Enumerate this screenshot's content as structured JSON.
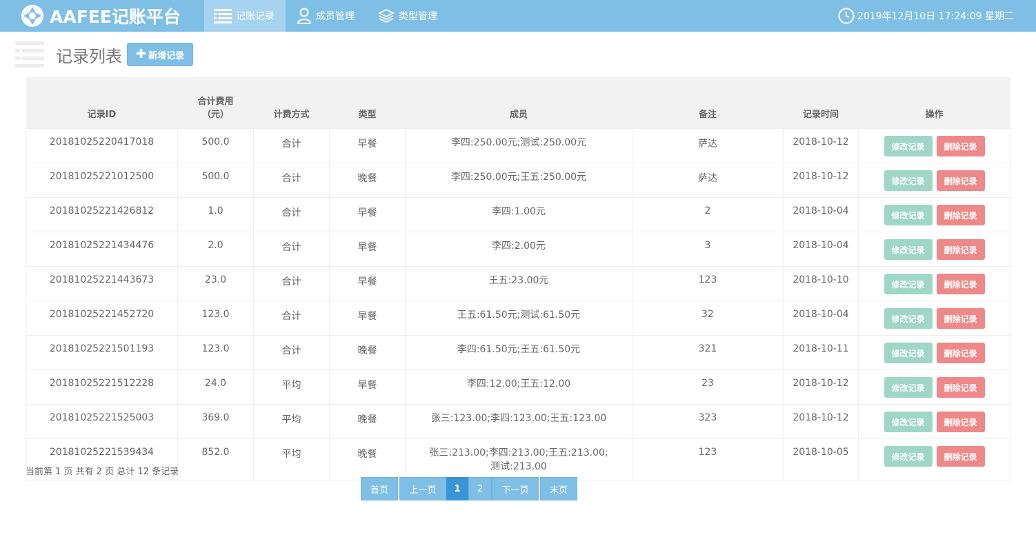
{
  "app": {
    "brand": "AAFEE记账平台",
    "nav": [
      {
        "label": "记账记录",
        "icon": "list-icon",
        "active": true
      },
      {
        "label": "成员管理",
        "icon": "user-icon",
        "active": false
      },
      {
        "label": "类型管理",
        "icon": "layers-icon",
        "active": false
      }
    ],
    "clock": "2019年12月10日 17:24:09 星期二"
  },
  "page": {
    "title": "记录列表",
    "add_button": "新增记录"
  },
  "table": {
    "headers": [
      "记录ID",
      "合计费用\n（元）",
      "计费方式",
      "类型",
      "成员",
      "备注",
      "记录时间",
      "操作"
    ],
    "edit_label": "修改记录",
    "delete_label": "删除记录",
    "rows": [
      {
        "id": "20181025220417018",
        "total": "500.0",
        "method": "合计",
        "type": "早餐",
        "members": "李四:250.00元;测试:250.00元",
        "note": "萨达",
        "date": "2018-10-12"
      },
      {
        "id": "20181025221012500",
        "total": "500.0",
        "method": "合计",
        "type": "晚餐",
        "members": "李四:250.00元;王五:250.00元",
        "note": "萨达",
        "date": "2018-10-12"
      },
      {
        "id": "20181025221426812",
        "total": "1.0",
        "method": "合计",
        "type": "早餐",
        "members": "李四:1.00元",
        "note": "2",
        "date": "2018-10-04"
      },
      {
        "id": "20181025221434476",
        "total": "2.0",
        "method": "合计",
        "type": "早餐",
        "members": "李四:2.00元",
        "note": "3",
        "date": "2018-10-04"
      },
      {
        "id": "20181025221443673",
        "total": "23.0",
        "method": "合计",
        "type": "早餐",
        "members": "王五:23.00元",
        "note": "123",
        "date": "2018-10-10"
      },
      {
        "id": "20181025221452720",
        "total": "123.0",
        "method": "合计",
        "type": "早餐",
        "members": "王五:61.50元;测试:61.50元",
        "note": "32",
        "date": "2018-10-04"
      },
      {
        "id": "20181025221501193",
        "total": "123.0",
        "method": "合计",
        "type": "晚餐",
        "members": "李四:61.50元;王五:61.50元",
        "note": "321",
        "date": "2018-10-11"
      },
      {
        "id": "20181025221512228",
        "total": "24.0",
        "method": "平均",
        "type": "早餐",
        "members": "李四:12.00;王五:12.00",
        "note": "23",
        "date": "2018-10-12"
      },
      {
        "id": "20181025221525003",
        "total": "369.0",
        "method": "平均",
        "type": "晚餐",
        "members": "张三:123.00;李四:123.00;王五:123.00",
        "note": "323",
        "date": "2018-10-12"
      },
      {
        "id": "20181025221539434",
        "total": "852.0",
        "method": "平均",
        "type": "晚餐",
        "members": "张三:213.00;李四:213.00;王五:213.00;测试:213.00",
        "note": "123",
        "date": "2018-10-05"
      }
    ]
  },
  "footer": {
    "page_info": "当前第 1 页 共有 2 页 总计 12 条记录",
    "pager": [
      {
        "label": "首页",
        "current": false
      },
      {
        "label": "上一页",
        "current": false
      },
      {
        "label": "1",
        "current": true
      },
      {
        "label": "2",
        "current": false
      },
      {
        "label": "下一页",
        "current": false
      },
      {
        "label": "末页",
        "current": false
      }
    ]
  },
  "colors": {
    "navbar": "#7fbfe6",
    "nav_active": "#a6d3ef",
    "edit_button": "#9fd6c6",
    "delete_button": "#ef8888",
    "pager_current": "#3a95d6"
  }
}
